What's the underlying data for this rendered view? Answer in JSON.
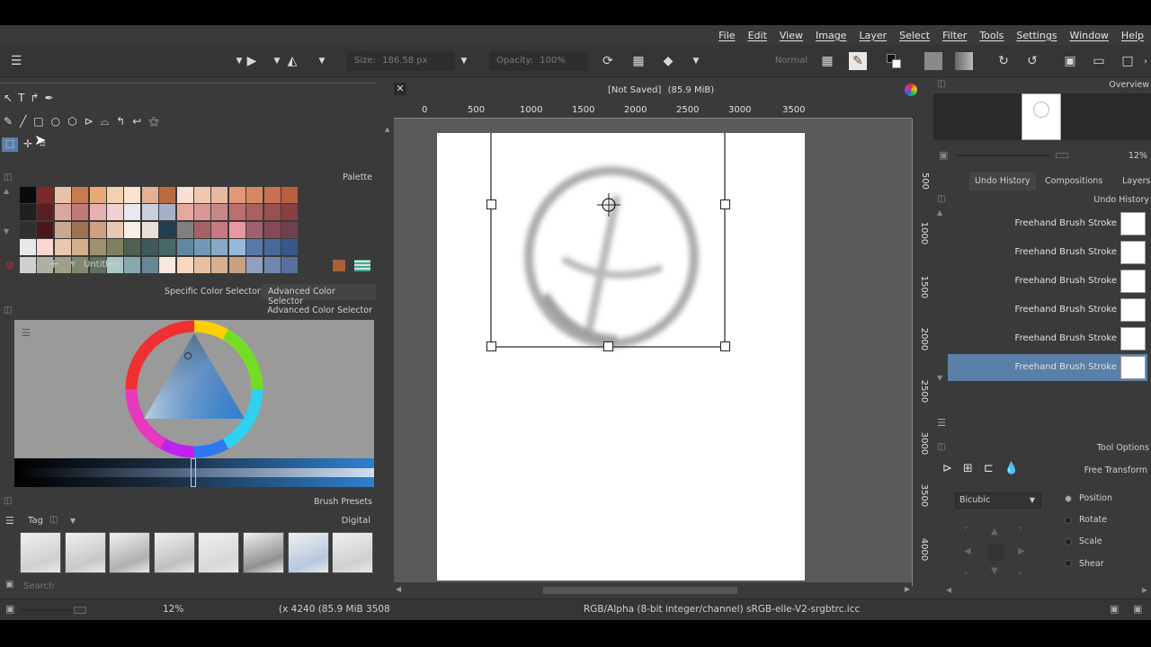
{
  "menu": [
    "Help",
    "Window",
    "Settings",
    "Tools",
    "Filter",
    "Select",
    "Layer",
    "Image",
    "View",
    "Edit",
    "File"
  ],
  "toolbar": {
    "size_label": "Size:",
    "size_value": "186.58 px",
    "opacity_label": "Opacity:",
    "opacity_value": "100%",
    "blend_mode": "Normal"
  },
  "palette": {
    "title": "Palette",
    "name": "Untitled",
    "colors": [
      [
        "#0a0a0a",
        "#7a2a2a",
        "#e8c2a8",
        "#c87a50",
        "#e8a878",
        "#f5d0b0",
        "#f8e4d0",
        "#e4b090",
        "#b86a40",
        "#f8e0d8",
        "#f0c8b0",
        "#e8b8a0",
        "#e09878",
        "#d88860",
        "#c87050",
        "#b86040"
      ],
      [
        "#202020",
        "#5a2020",
        "#d8a8a0",
        "#c07878",
        "#e8b0b0",
        "#f0d0d0",
        "#e8e8f0",
        "#c8d0e0",
        "#a8b0c8",
        "#e8a8a0",
        "#d89898",
        "#c88888",
        "#b87070",
        "#a86060",
        "#985050",
        "#884040"
      ],
      [
        "#303030",
        "#4a1818",
        "#c8a890",
        "#a07050",
        "#d0a080",
        "#e8c8b0",
        "#f8f0e8",
        "#e8e0d8",
        "#204050",
        "#808080",
        "#a86068",
        "#c87880",
        "#e898a0",
        "#a06070",
        "#884858",
        "#704050"
      ],
      [
        "#e8e8e8",
        "#f8d8d0",
        "#e8c8b0",
        "#d0b090",
        "#a09070",
        "#808060",
        "#506050",
        "#405858",
        "#486868",
        "#6088a0",
        "#7098b8",
        "#88a8c8",
        "#98b8d8",
        "#5878a8",
        "#486898",
        "#385888"
      ],
      [
        "#d0d0d0",
        "#b0b0a0",
        "#a0a088",
        "#808870",
        "#607060",
        "#a8c8c8",
        "#88a8b0",
        "#688898",
        "#f8e8e0",
        "#f8d8c0",
        "#e8c0a0",
        "#d8b090",
        "#c8a080",
        "#90a0c0",
        "#7088b0",
        "#5870a0"
      ]
    ]
  },
  "color_selector": {
    "tab_specific": "Specific Color Selector",
    "tab_advanced": "Advanced Color Selector",
    "panel_title": "Advanced Color Selector",
    "hue_color": "#2f80d0"
  },
  "brush_presets": {
    "title": "Brush Presets",
    "tag_label": "Tag",
    "tag_value": "Digital",
    "search_placeholder": "Search",
    "count": 8
  },
  "canvas": {
    "title": "[Not Saved]",
    "memory": "(85.9 MiB)",
    "ruler_top": [
      "0",
      "500",
      "1000",
      "1500",
      "2000",
      "2500",
      "3000",
      "3500"
    ],
    "ruler_side": [
      "500",
      "1000",
      "1500",
      "2000",
      "2500",
      "3000",
      "3500",
      "4000"
    ]
  },
  "overview": {
    "title": "Overview",
    "zoom": "12%"
  },
  "undo": {
    "tab_undo": "Undo History",
    "tab_compositions": "Compositions",
    "tab_layers": "Layers",
    "panel_title": "Undo History",
    "items": [
      "Freehand Brush Stroke",
      "Freehand Brush Stroke",
      "Freehand Brush Stroke",
      "Freehand Brush Stroke",
      "Freehand Brush Stroke",
      "Freehand Brush Stroke"
    ],
    "selected_index": 5
  },
  "tool_options": {
    "title": "Tool Options",
    "mode": "Free Transform",
    "filter": "Bicubic",
    "options": [
      "Position",
      "Rotate",
      "Scale",
      "Shear"
    ]
  },
  "status": {
    "zoom": "12%",
    "coords": "(x 4240 (85.9 MiB 3508",
    "color_model": "RGB/Alpha (8-bit integer/channel)  sRGB-elle-V2-srgbtrc.icc"
  }
}
